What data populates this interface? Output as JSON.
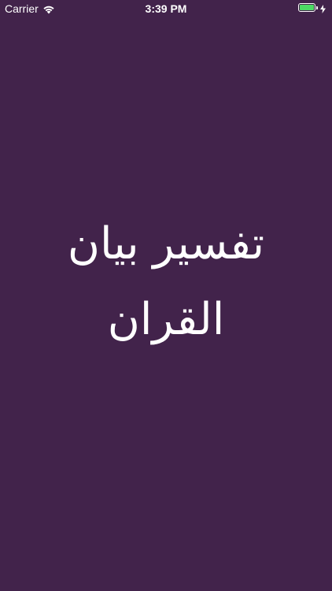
{
  "status_bar": {
    "carrier": "Carrier",
    "time": "3:39 PM",
    "wifi_icon": "wifi-icon",
    "battery_icon": "battery-icon",
    "battery_level": 1.0,
    "battery_color": "#4cd964",
    "charging_icon": "bolt-icon"
  },
  "splash": {
    "background_color": "#42234b",
    "title_line1": "تفسیر بیان",
    "title_line2": "القران"
  }
}
